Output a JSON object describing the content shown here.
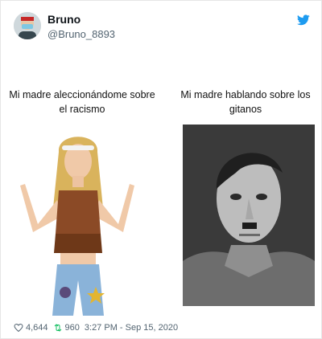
{
  "header": {
    "display_name": "Bruno",
    "handle": "@Bruno_8893",
    "brand_color": "#1d9bf0",
    "icon": "bird-icon"
  },
  "meme": {
    "left_caption": "Mi madre aleccionándome sobre el racismo",
    "right_caption": "Mi madre hablando sobre los gitanos"
  },
  "footer": {
    "likes": "4,644",
    "retweets": "960",
    "timestamp": "3:27 PM - Sep 15, 2020"
  }
}
